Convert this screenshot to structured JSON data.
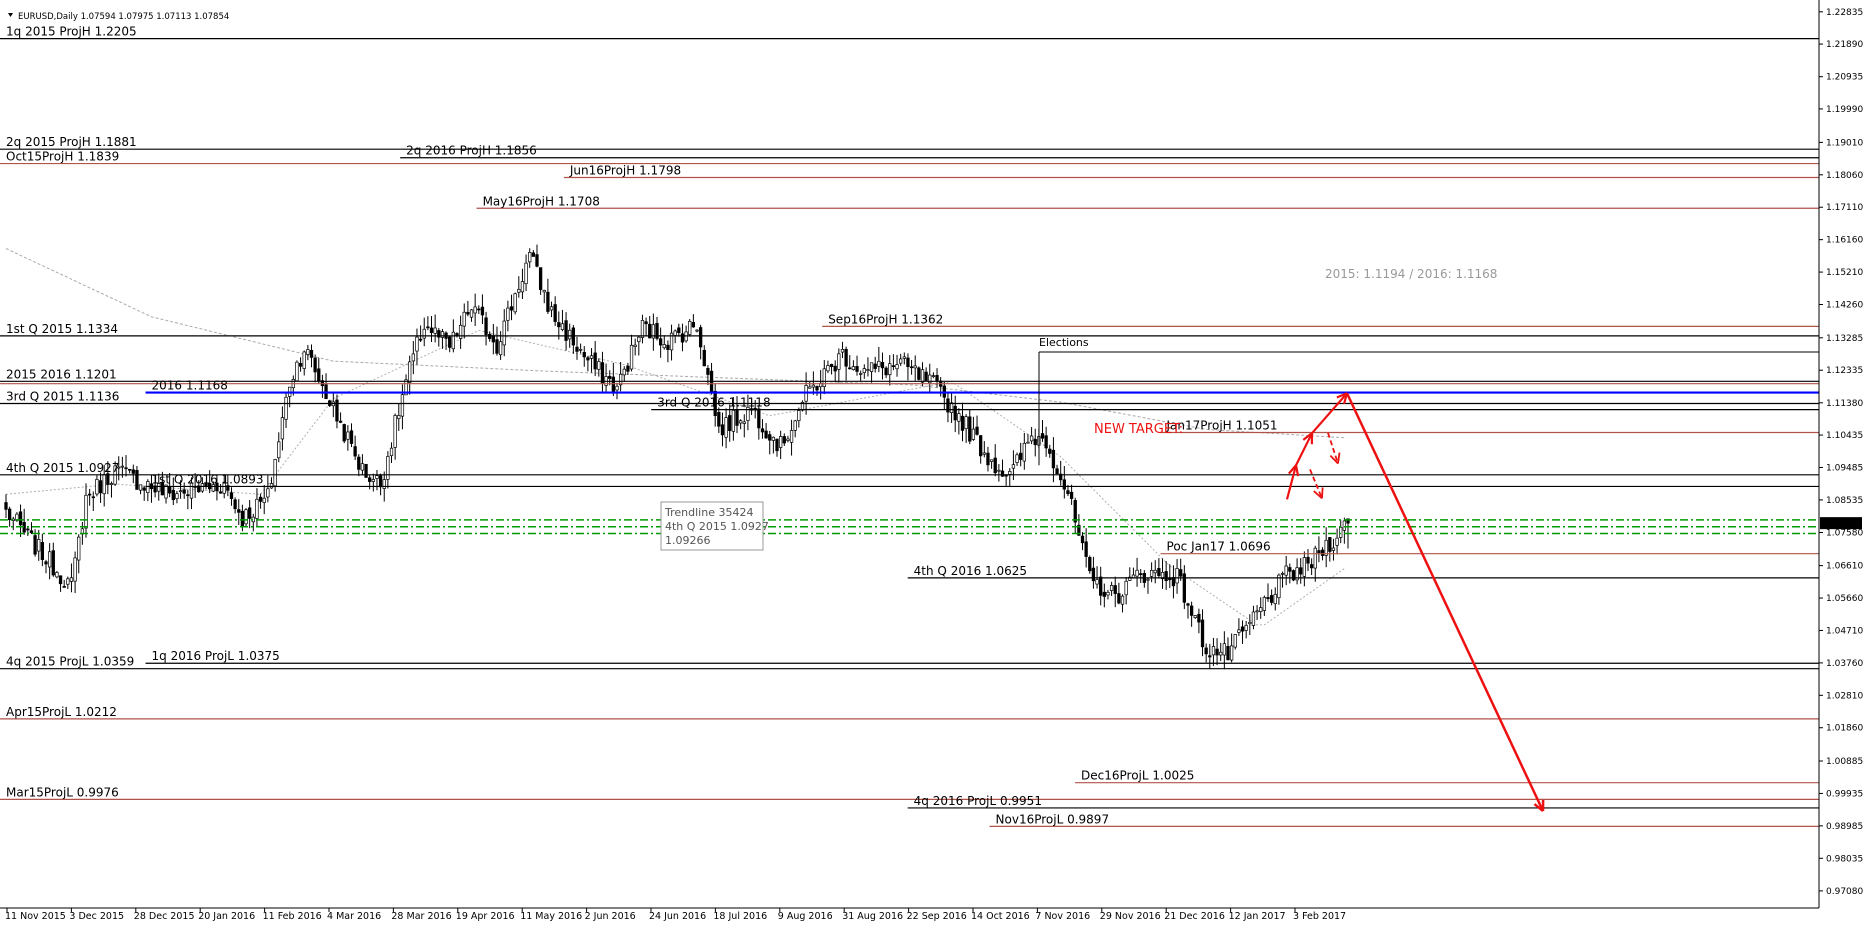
{
  "header": {
    "symbol_info": "EURUSD,Daily  1.07594 1.07975 1.07113 1.07854"
  },
  "chart_data": {
    "type": "candlestick",
    "symbol": "EURUSD",
    "timeframe": "Daily",
    "ohlc_last": {
      "open": 1.07594,
      "high": 1.07975,
      "low": 1.07113,
      "close": 1.07854
    },
    "ylim": [
      0.9693,
      1.2283
    ],
    "price_ticks": [
      "1.22835",
      "1.21890",
      "1.20935",
      "1.19990",
      "1.19010",
      "1.18060",
      "1.17110",
      "1.16160",
      "1.15210",
      "1.14260",
      "1.13285",
      "1.12335",
      "1.11380",
      "1.10435",
      "1.09485",
      "1.08535",
      "1.07580",
      "1.06610",
      "1.05660",
      "1.04710",
      "1.03760",
      "1.02810",
      "1.01860",
      "1.00885",
      "0.99935",
      "0.98985",
      "0.98035",
      "0.97080"
    ],
    "current_price": "1.07854",
    "date_ticks": [
      "11 Nov 2015",
      "3 Dec 2015",
      "28 Dec 2015",
      "20 Jan 2016",
      "11 Feb 2016",
      "4 Mar 2016",
      "28 Mar 2016",
      "19 Apr 2016",
      "11 May 2016",
      "2 Jun 2016",
      "24 Jun 2016",
      "18 Jul 2016",
      "9 Aug 2016",
      "31 Aug 2016",
      "22 Sep 2016",
      "14 Oct 2016",
      "7 Nov 2016",
      "29 Nov 2016",
      "21 Dec 2016",
      "12 Jan 2017",
      "3 Feb 2017"
    ],
    "anchors": [
      [
        0,
        1.082
      ],
      [
        8,
        1.072
      ],
      [
        18,
        1.06
      ],
      [
        22,
        1.086
      ],
      [
        30,
        1.094
      ],
      [
        45,
        1.087
      ],
      [
        60,
        1.09
      ],
      [
        65,
        1.08
      ],
      [
        72,
        1.086
      ],
      [
        78,
        1.12
      ],
      [
        82,
        1.13
      ],
      [
        90,
        1.112
      ],
      [
        98,
        1.094
      ],
      [
        103,
        1.09
      ],
      [
        110,
        1.12
      ],
      [
        115,
        1.137
      ],
      [
        122,
        1.13
      ],
      [
        128,
        1.142
      ],
      [
        135,
        1.131
      ],
      [
        144,
        1.157
      ],
      [
        150,
        1.14
      ],
      [
        160,
        1.126
      ],
      [
        168,
        1.118
      ],
      [
        175,
        1.136
      ],
      [
        182,
        1.132
      ],
      [
        190,
        1.137
      ],
      [
        196,
        1.106
      ],
      [
        205,
        1.112
      ],
      [
        213,
        1.101
      ],
      [
        220,
        1.116
      ],
      [
        230,
        1.128
      ],
      [
        236,
        1.123
      ],
      [
        246,
        1.125
      ],
      [
        255,
        1.119
      ],
      [
        262,
        1.11
      ],
      [
        270,
        1.098
      ],
      [
        276,
        1.092
      ],
      [
        282,
        1.104
      ],
      [
        286,
        1.103
      ],
      [
        292,
        1.087
      ],
      [
        298,
        1.062
      ],
      [
        305,
        1.057
      ],
      [
        312,
        1.064
      ],
      [
        322,
        1.063
      ],
      [
        330,
        1.042
      ],
      [
        336,
        1.04
      ],
      [
        340,
        1.046
      ],
      [
        346,
        1.055
      ],
      [
        352,
        1.063
      ],
      [
        358,
        1.066
      ],
      [
        362,
        1.071
      ],
      [
        366,
        1.075
      ],
      [
        369,
        1.0785
      ]
    ],
    "volatility": 0.006,
    "moving_average": [
      [
        0,
        1.159
      ],
      [
        40,
        1.139
      ],
      [
        90,
        1.126
      ],
      [
        150,
        1.123
      ],
      [
        200,
        1.121
      ],
      [
        250,
        1.119
      ],
      [
        290,
        1.114
      ],
      [
        330,
        1.106
      ],
      [
        369,
        1.1035
      ]
    ],
    "ema_fast": [
      [
        0,
        1.087
      ],
      [
        30,
        1.09
      ],
      [
        70,
        1.087
      ],
      [
        90,
        1.115
      ],
      [
        130,
        1.135
      ],
      [
        170,
        1.125
      ],
      [
        210,
        1.11
      ],
      [
        260,
        1.12
      ],
      [
        290,
        1.098
      ],
      [
        320,
        1.066
      ],
      [
        345,
        1.048
      ],
      [
        369,
        1.066
      ]
    ],
    "hlines": [
      {
        "price": 1.2205,
        "x1": 0,
        "x2": 1,
        "color": "#000000",
        "label": "1q 2015 ProjH 1.2205",
        "lx": 0
      },
      {
        "price": 1.1881,
        "x1": 0,
        "x2": 1,
        "color": "#000000",
        "label": "2q 2015 ProjH 1.1881",
        "lx": 0
      },
      {
        "price": 1.1856,
        "x1": 0.22,
        "x2": 1,
        "color": "#000000",
        "label": "2q 2016 ProjH 1.1856",
        "lx": 0.22
      },
      {
        "price": 1.1839,
        "x1": 0,
        "x2": 1,
        "color": "#b2534a",
        "label": "Oct15ProjH 1.1839",
        "lx": 0
      },
      {
        "price": 1.1798,
        "x1": 0.31,
        "x2": 1,
        "color": "#b2534a",
        "label": "Jun16ProjH 1.1798",
        "lx": 0.31
      },
      {
        "price": 1.1708,
        "x1": 0.262,
        "x2": 1,
        "color": "#b2534a",
        "label": "May16ProjH 1.1708",
        "lx": 0.262
      },
      {
        "price": 1.1362,
        "x1": 0.452,
        "x2": 1,
        "color": "#b2534a",
        "label": "Sep16ProjH 1.1362",
        "lx": 0.452
      },
      {
        "price": 1.1334,
        "x1": 0,
        "x2": 1,
        "color": "#000000",
        "label": "1st Q 2015 1.1334",
        "lx": 0
      },
      {
        "price": 1.1201,
        "x1": 0,
        "x2": 1,
        "color": "#000000",
        "label": "2015 2016  1.1201",
        "lx": 0
      },
      {
        "price": 1.1194,
        "x1": 0,
        "x2": 1,
        "color": "#b2534a",
        "label": "",
        "lx": 0
      },
      {
        "price": 1.1168,
        "x1": 0.08,
        "x2": 1,
        "color": "#0000ff",
        "label": "2016 1.1168",
        "lx": 0.08
      },
      {
        "price": 1.1136,
        "x1": 0,
        "x2": 1,
        "color": "#000000",
        "label": "3rd Q 2015 1.1136",
        "lx": 0
      },
      {
        "price": 1.1118,
        "x1": 0.358,
        "x2": 1,
        "color": "#000000",
        "label": "3rd Q 2016 1.1118",
        "lx": 0.358
      },
      {
        "price": 1.1051,
        "x1": 0.638,
        "x2": 1,
        "color": "#b2534a",
        "label": "Jan17ProjH 1.1051",
        "lx": 0.638
      },
      {
        "price": 1.0927,
        "x1": 0,
        "x2": 1,
        "color": "#000000",
        "label": "4th Q 2015 1.0927",
        "lx": 0
      },
      {
        "price": 1.0893,
        "x1": 0.08,
        "x2": 1,
        "color": "#000000",
        "label": "1st Q 2016 1.0893",
        "lx": 0.08
      },
      {
        "price": 1.0696,
        "x1": 0.638,
        "x2": 1,
        "color": "#b2534a",
        "label": "Poc Jan17 1.0696",
        "lx": 0.638
      },
      {
        "price": 1.0625,
        "x1": 0.499,
        "x2": 1,
        "color": "#000000",
        "label": "4th Q 2016 1.0625",
        "lx": 0.499
      },
      {
        "price": 1.0375,
        "x1": 0.08,
        "x2": 1,
        "color": "#000000",
        "label": "1q 2016 ProjL 1.0375",
        "lx": 0.08
      },
      {
        "price": 1.0359,
        "x1": 0,
        "x2": 1,
        "color": "#000000",
        "label": "4q 2015 ProjL 1.0359",
        "lx": 0
      },
      {
        "price": 1.0212,
        "x1": 0,
        "x2": 1,
        "color": "#b2534a",
        "label": "Apr15ProjL 1.0212",
        "lx": 0
      },
      {
        "price": 1.0025,
        "x1": 0.591,
        "x2": 1,
        "color": "#b2534a",
        "label": "Dec16ProjL 1.0025",
        "lx": 0.591
      },
      {
        "price": 0.9976,
        "x1": 0,
        "x2": 1,
        "color": "#b2534a",
        "label": "Mar15ProjL 0.9976",
        "lx": 0
      },
      {
        "price": 0.9951,
        "x1": 0.499,
        "x2": 1,
        "color": "#000000",
        "label": "4q 2016 ProjL 0.9951",
        "lx": 0.499
      },
      {
        "price": 0.9897,
        "x1": 0.544,
        "x2": 1,
        "color": "#b2534a",
        "label": "Nov16ProjL 0.9897",
        "lx": 0.544
      }
    ],
    "green_lines": [
      1.0795,
      1.0775,
      1.0755
    ],
    "annotations": {
      "avg_text": "2015: 1.1194 / 2016: 1.1168",
      "new_target": "NEW TARGET:",
      "elections": "Elections",
      "tooltip": [
        "Trendline 35424",
        "4th Q 2015 1.0927",
        "1.09266"
      ]
    },
    "forecast_path": [
      [
        1.0855,
        1.0955
      ],
      [
        1.0955,
        1.1049
      ],
      [
        1.1049,
        1.1166
      ],
      [
        1.1166,
        0.9942
      ]
    ],
    "colors": {
      "bull": "#ffffff",
      "bear": "#000000",
      "projection": "#b2534a",
      "blue": "#0000ff",
      "green": "#009900",
      "forecast": "#ee1111"
    }
  }
}
